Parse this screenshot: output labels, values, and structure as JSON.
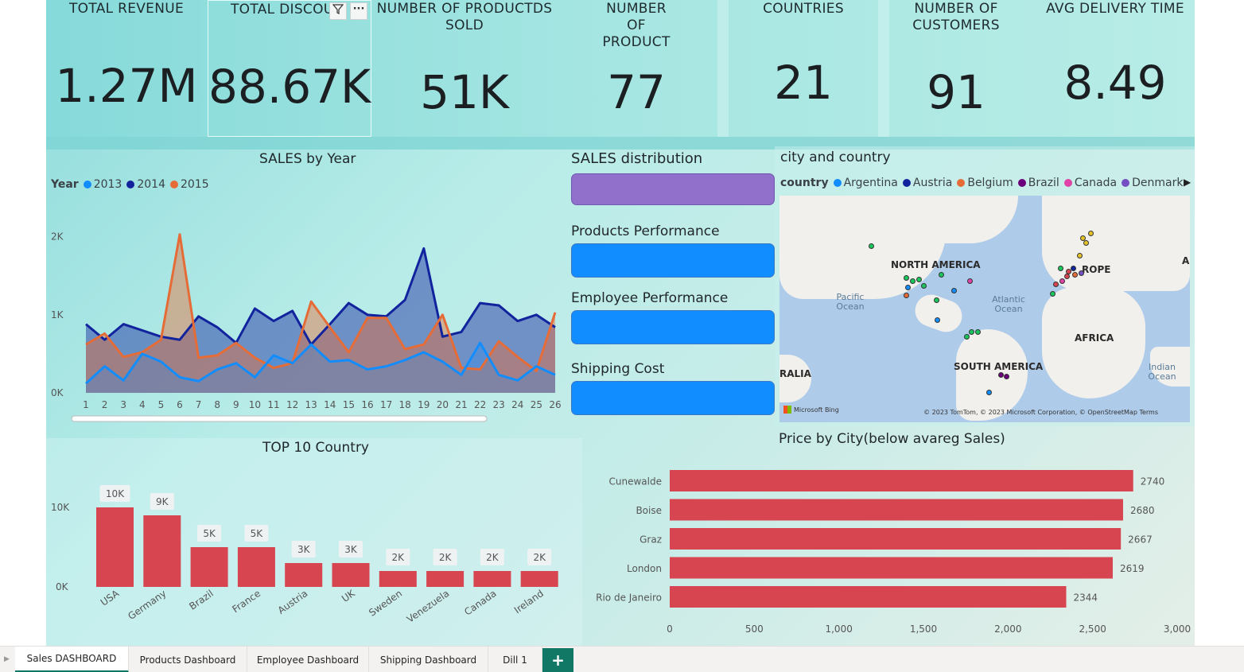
{
  "kpis": [
    {
      "label": "TOTAL REVENUE",
      "value": "1.27M"
    },
    {
      "label": "TOTAL DISCOU",
      "value": "88.67K"
    },
    {
      "label": "NUMBER OF PRODUCTDS SOLD",
      "value": "51K"
    },
    {
      "label": "NUMBER OF PRODUCT",
      "value": "77"
    },
    {
      "label": "COUNTRIES",
      "value": "21"
    },
    {
      "label": "NUMBER OF CUSTOMERS",
      "value": "91"
    },
    {
      "label": "AVG DELIVERY TIME",
      "value": "8.49"
    }
  ],
  "icons": {
    "filter": "filter-icon",
    "more": "more-options-icon",
    "next": "chevron-right-icon"
  },
  "colors": {
    "y2013": "#118dff",
    "y2014": "#12239e",
    "y2015": "#e66c37",
    "bar": "#d64550",
    "nav_purple": "#9170cc",
    "nav_blue": "#118dff",
    "tab_accent": "#117865"
  },
  "sales_by_year": {
    "title": "SALES by Year",
    "legend_title": "Year"
  },
  "nav": {
    "sales_distribution": "SALES distribution",
    "products": "Products Performance",
    "employees": "Employee Performance",
    "shipping": "Shipping Cost"
  },
  "map": {
    "title": "city and country",
    "legend_title": "country",
    "legend": [
      {
        "name": "Argentina",
        "color": "#118dff"
      },
      {
        "name": "Austria",
        "color": "#12239e"
      },
      {
        "name": "Belgium",
        "color": "#e66c37"
      },
      {
        "name": "Brazil",
        "color": "#6b007b"
      },
      {
        "name": "Canada",
        "color": "#e044a7"
      },
      {
        "name": "Denmark",
        "color": "#744ec2"
      }
    ],
    "labels": {
      "na": "NORTH AMERICA",
      "eu": "ROPE",
      "af": "AFRICA",
      "sa": "SOUTH AMERICA",
      "au": "RALIA",
      "a": "A"
    },
    "oceans": {
      "pacific": "Pacific Ocean",
      "atlantic": "Atlantic Ocean",
      "indian": "Indian Ocean"
    },
    "attribution": "© 2023 TomTom, © 2023 Microsoft Corporation, © OpenStreetMap  Terms",
    "brand": "Microsoft Bing"
  },
  "top10_title": "TOP 10 Country",
  "price_title": "Price by City(below avareg Sales)",
  "tabs": [
    "Sales DASHBOARD",
    "Products Dashboard",
    "Employee Dashboard",
    "Shipping Dashboard",
    "Dill 1"
  ],
  "tab_add": "+",
  "chart_data": [
    {
      "type": "area",
      "title": "SALES by Year",
      "legend_title": "Year",
      "x": [
        1,
        2,
        3,
        4,
        5,
        6,
        7,
        8,
        9,
        10,
        11,
        12,
        13,
        14,
        15,
        16,
        17,
        18,
        19,
        20,
        21,
        22,
        23,
        24,
        25,
        26
      ],
      "yticks": [
        "0K",
        "1K",
        "2K"
      ],
      "ylim": [
        0,
        2200
      ],
      "series": [
        {
          "name": "2013",
          "values": [
            120,
            340,
            160,
            500,
            400,
            200,
            150,
            300,
            380,
            200,
            480,
            380,
            620,
            400,
            420,
            300,
            340,
            420,
            520,
            400,
            230,
            640,
            230,
            160,
            340,
            230
          ]
        },
        {
          "name": "2014",
          "values": [
            880,
            680,
            880,
            800,
            720,
            680,
            980,
            840,
            640,
            1080,
            920,
            1050,
            620,
            880,
            1150,
            1000,
            980,
            1190,
            1850,
            720,
            780,
            1150,
            1120,
            920,
            1000,
            840
          ]
        },
        {
          "name": "2015",
          "values": [
            620,
            760,
            460,
            520,
            680,
            2030,
            450,
            480,
            640,
            450,
            320,
            380,
            1170,
            840,
            520,
            960,
            960,
            560,
            620,
            1000,
            320,
            300,
            660,
            460,
            280,
            1030
          ]
        }
      ]
    },
    {
      "type": "bar",
      "title": "TOP 10 Country",
      "categories": [
        "USA",
        "Germany",
        "Brazil",
        "France",
        "Austria",
        "UK",
        "Sweden",
        "Venezuela",
        "Canada",
        "Ireland"
      ],
      "values": [
        10000,
        9000,
        5000,
        5000,
        3000,
        3000,
        2000,
        2000,
        2000,
        2000
      ],
      "data_labels": [
        "10K",
        "9K",
        "5K",
        "5K",
        "3K",
        "3K",
        "2K",
        "2K",
        "2K",
        "2K"
      ],
      "yticks": [
        "0K",
        "10K"
      ],
      "ylim": [
        0,
        11000
      ]
    },
    {
      "type": "bar",
      "orientation": "horizontal",
      "title": "Price by City(below avareg Sales)",
      "categories": [
        "Cunewalde",
        "Boise",
        "Graz",
        "London",
        "Rio de Janeiro"
      ],
      "values": [
        2740,
        2680,
        2667,
        2619,
        2344
      ],
      "xticks": [
        "0",
        "500",
        "1,000",
        "1,500",
        "2,000",
        "2,500",
        "3,000"
      ],
      "xlim": [
        0,
        3000
      ]
    }
  ]
}
